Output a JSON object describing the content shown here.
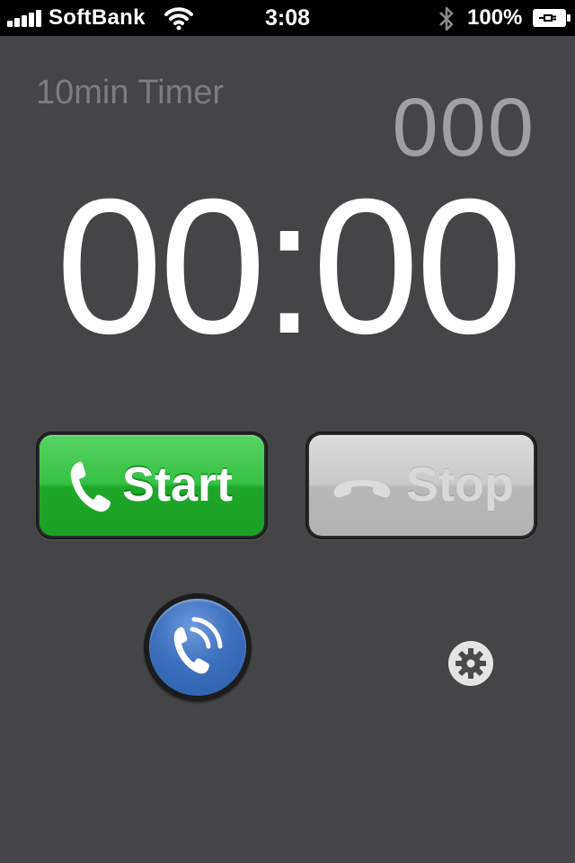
{
  "status_bar": {
    "carrier": "SoftBank",
    "time": "3:08",
    "battery_percent": "100%"
  },
  "timer": {
    "title": "10min Timer",
    "counter": "000",
    "display": "00:00"
  },
  "buttons": {
    "start_label": "Start",
    "stop_label": "Stop"
  },
  "icons": {
    "signal": "signal-bars-icon",
    "wifi": "wifi-icon",
    "bluetooth": "bluetooth-icon",
    "battery": "battery-charging-icon",
    "start": "phone-handset-icon",
    "stop": "hang-up-icon",
    "call": "phone-ringing-icon",
    "settings": "gear-icon"
  },
  "colors": {
    "background": "#454446",
    "start_green": "#35c244",
    "stop_gray": "#c9c9c9",
    "call_blue": "#3c70bd"
  }
}
